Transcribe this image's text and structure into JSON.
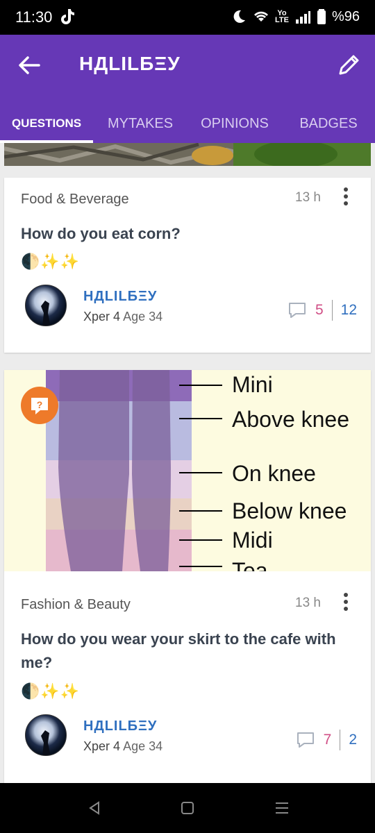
{
  "status_bar": {
    "time": "11:30",
    "battery": "%96",
    "network_label": "Yo\nLTE"
  },
  "app_bar": {
    "title": "НДLILБΞУ",
    "tabs": [
      {
        "label": "QUESTIONS",
        "active": true
      },
      {
        "label": "MYTAKES",
        "active": false
      },
      {
        "label": "OPINIONS",
        "active": false
      },
      {
        "label": "BADGES",
        "active": false
      }
    ]
  },
  "posts": [
    {
      "category": "Food & Beverage",
      "time_ago": "13 h",
      "question": "How do you eat corn?",
      "emoji": "🌓✨✨",
      "author": "НДLILБΞУ",
      "xper_label": "Xper 4",
      "age_label": "Age 34",
      "comments": "5",
      "votes": "12"
    },
    {
      "category": "Fashion & Beauty",
      "time_ago": "13 h",
      "question": "How do you wear your skirt to the cafe with me?",
      "emoji": "🌓✨✨",
      "author": "НДLILБΞУ",
      "xper_label": "Xper 4",
      "age_label": "Age 34",
      "comments": "7",
      "votes": "2",
      "image_labels": [
        "Mini",
        "Above knee",
        "On knee",
        "Below knee",
        "Midi",
        "Tea"
      ]
    }
  ],
  "colors": {
    "app_bar": "#6638b6",
    "author": "#2f6fbf",
    "comments": "#d04f86",
    "question_badge": "#ee7a2a"
  }
}
